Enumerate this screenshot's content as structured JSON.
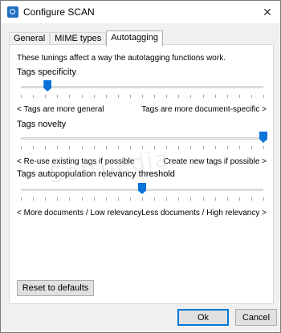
{
  "window": {
    "title": "Configure SCAN",
    "close": "✕"
  },
  "tabs": [
    {
      "label": "General",
      "active": false
    },
    {
      "label": "MIME types",
      "active": false
    },
    {
      "label": "Autotagging",
      "active": true
    }
  ],
  "panel": {
    "intro": "These tunings affect a way the autotagging functions work.",
    "sliders": [
      {
        "label": "Tags specificity",
        "value_fraction": 0.11,
        "min_label": "< Tags are more general",
        "max_label": "Tags are more document-specific >"
      },
      {
        "label": "Tags novelty",
        "value_fraction": 1.0,
        "min_label": "< Re-use existing tags if possible",
        "max_label": "Create new tags if possible >"
      },
      {
        "label": "Tags autopopulation relevancy threshold",
        "value_fraction": 0.5,
        "min_label": "< More documents / Low relevancy",
        "max_label": "Less documents / High relevancy >"
      }
    ],
    "reset_label": "Reset to defaults"
  },
  "buttons": {
    "ok": "Ok",
    "cancel": "Cancel"
  },
  "watermark": "Softpedia",
  "colors": {
    "slider_thumb": "#0a74da",
    "default_button_border": "#0078d7"
  }
}
